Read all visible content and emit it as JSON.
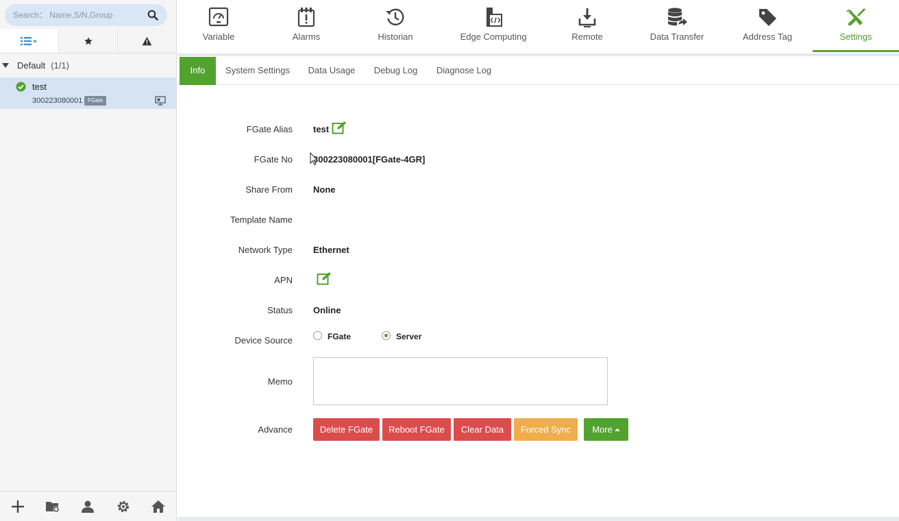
{
  "sidebar": {
    "search": {
      "placeholder": "Search： Name,S/N,Group",
      "icon": "search-icon"
    },
    "tabs": [
      {
        "icon": "list-icon",
        "active": true
      },
      {
        "icon": "star-icon",
        "active": false
      },
      {
        "icon": "warning-icon",
        "active": false
      }
    ],
    "group": {
      "name": "Default",
      "count": "(1/1)"
    },
    "device": {
      "name": "test",
      "serial": "300223080001",
      "badge": "FGate",
      "status": "online"
    },
    "bottom_icons": [
      "add-icon",
      "folder-settings-icon",
      "user-icon",
      "gear-icon",
      "home-icon"
    ]
  },
  "topnav": {
    "items": [
      {
        "label": "Variable",
        "icon": "gauge-icon"
      },
      {
        "label": "Alarms",
        "icon": "alarm-clipboard-icon"
      },
      {
        "label": "Historian",
        "icon": "history-icon"
      },
      {
        "label": "Edge Computing",
        "icon": "code-file-icon"
      },
      {
        "label": "Remote",
        "icon": "download-tray-icon"
      },
      {
        "label": "Data Transfer",
        "icon": "database-transfer-icon"
      },
      {
        "label": "Address Tag",
        "icon": "tag-icon"
      },
      {
        "label": "Settings",
        "icon": "tools-icon",
        "active": true
      }
    ]
  },
  "subtabs": [
    {
      "label": "Info",
      "active": true
    },
    {
      "label": "System Settings"
    },
    {
      "label": "Data Usage"
    },
    {
      "label": "Debug Log"
    },
    {
      "label": "Diagnose Log"
    }
  ],
  "form": {
    "alias": {
      "label": "FGate Alias",
      "value": "test"
    },
    "no": {
      "label": "FGate No",
      "value": "300223080001[FGate-4GR]"
    },
    "share": {
      "label": "Share From",
      "value": "None"
    },
    "template": {
      "label": "Template Name",
      "value": ""
    },
    "network": {
      "label": "Network Type",
      "value": "Ethernet"
    },
    "apn": {
      "label": "APN"
    },
    "status": {
      "label": "Status",
      "value": "Online"
    },
    "source": {
      "label": "Device Source",
      "options": [
        "FGate",
        "Server"
      ],
      "selected": "Server"
    },
    "memo": {
      "label": "Memo",
      "value": ""
    },
    "advance": {
      "label": "Advance",
      "buttons": {
        "delete": "Delete FGate",
        "reboot": "Reboot FGate",
        "clear": "Clear Data",
        "sync": "Forced Sync",
        "more": "More"
      }
    }
  },
  "colors": {
    "accent": "#52a22f",
    "danger": "#db4c4c",
    "warning": "#f0ad4e",
    "sidebar_selected": "#d5e3f3"
  }
}
